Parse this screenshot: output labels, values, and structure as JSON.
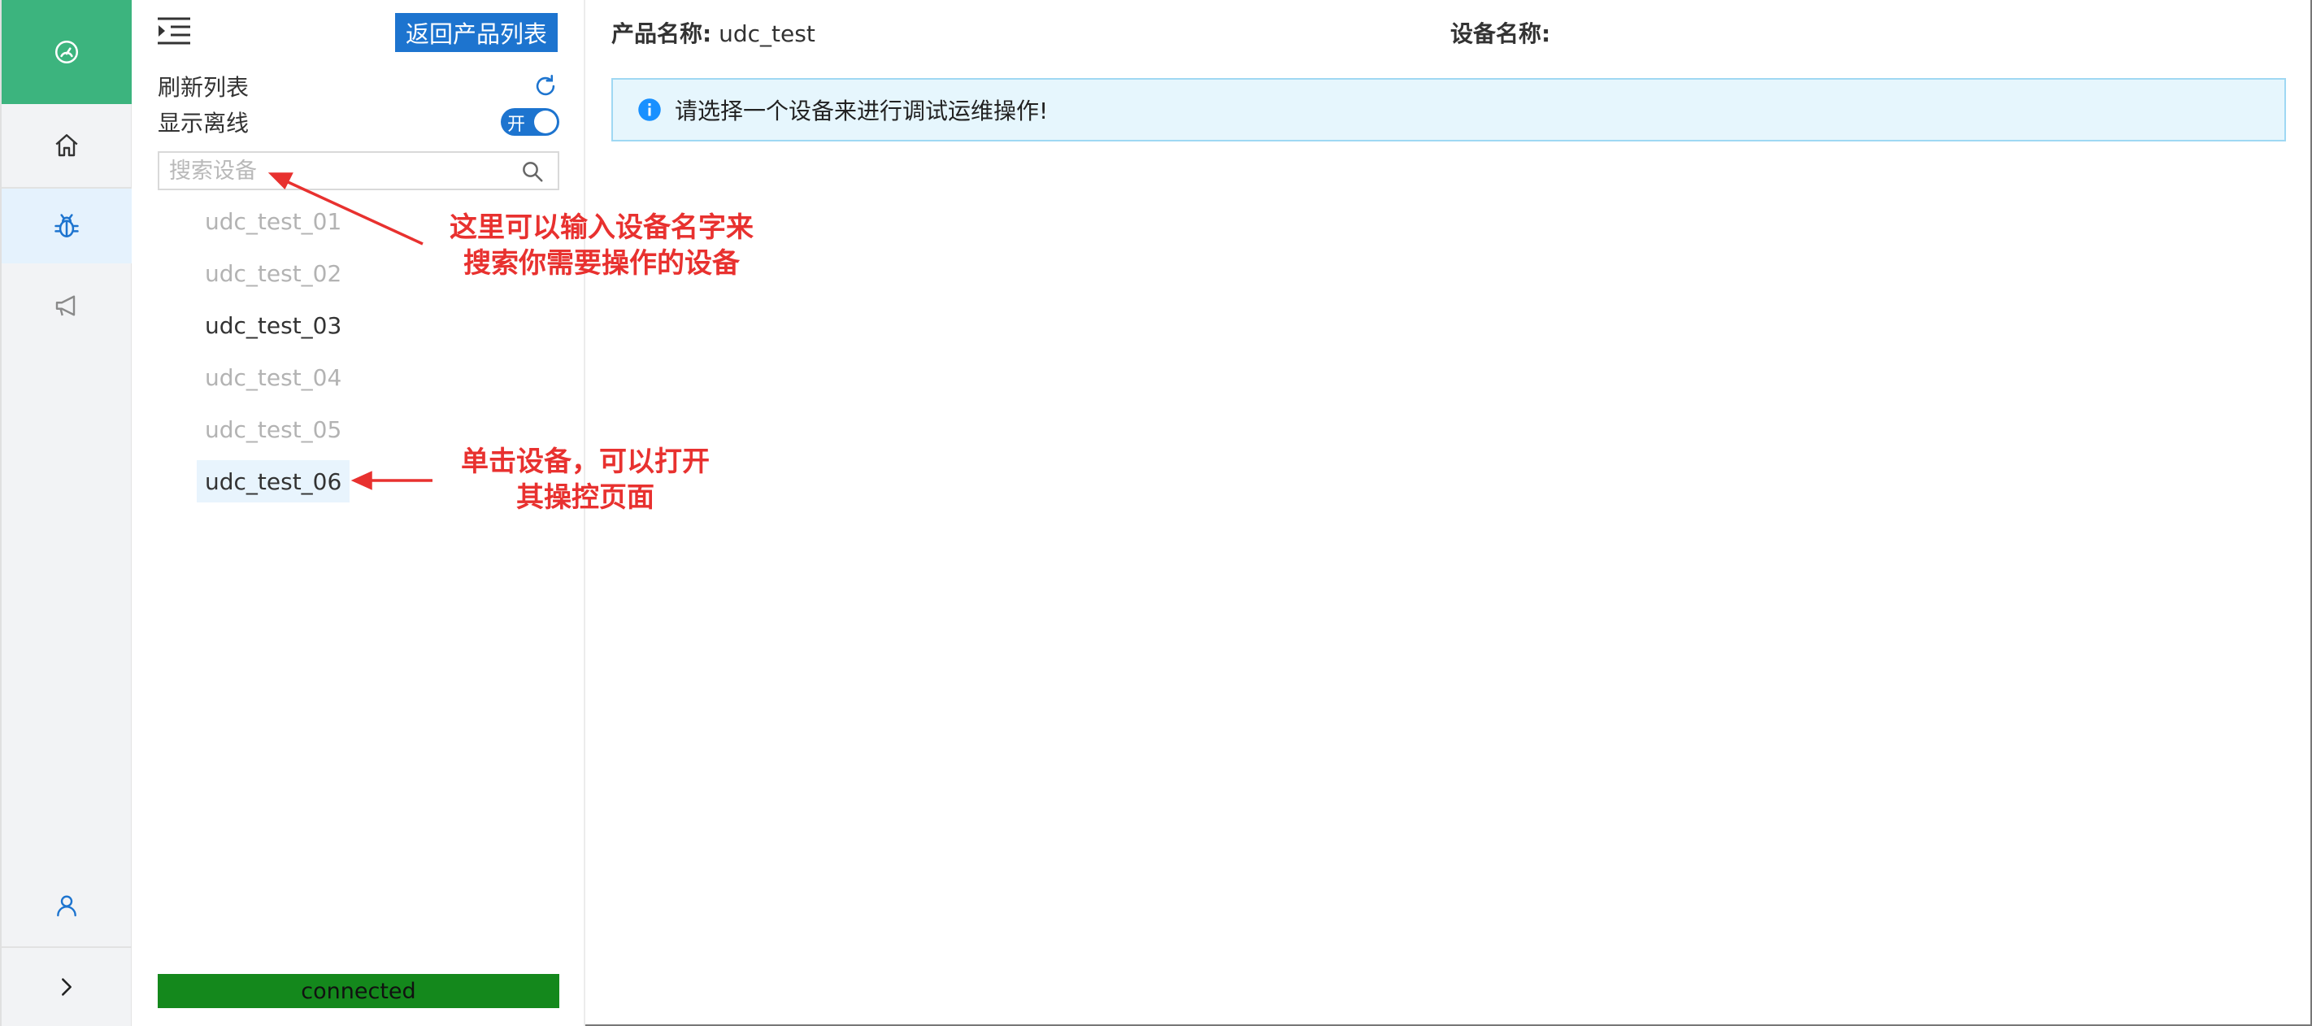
{
  "rail": {
    "items": [
      {
        "id": "dashboard",
        "icon": "dashboard-icon"
      },
      {
        "id": "home",
        "icon": "home-icon"
      },
      {
        "id": "debug",
        "icon": "bug-icon",
        "active": true
      },
      {
        "id": "broadcast",
        "icon": "megaphone-icon"
      },
      {
        "id": "user",
        "icon": "user-icon"
      },
      {
        "id": "expand",
        "icon": "chevron-right-icon"
      }
    ],
    "colors": {
      "logo_bg": "#3cb47e",
      "active_bg": "#e5f2fd",
      "icon": "#333333",
      "active_icon": "#1d74cf"
    }
  },
  "sidebar": {
    "back_button_label": "返回产品列表",
    "refresh_label": "刷新列表",
    "show_offline_label": "显示离线",
    "show_offline_toggle": {
      "on": true,
      "label": "开"
    },
    "search": {
      "placeholder": "搜索设备",
      "value": ""
    },
    "devices": [
      {
        "name": "udc_test_01",
        "online": false,
        "selected": false
      },
      {
        "name": "udc_test_02",
        "online": false,
        "selected": false
      },
      {
        "name": "udc_test_03",
        "online": true,
        "selected": false
      },
      {
        "name": "udc_test_04",
        "online": false,
        "selected": false
      },
      {
        "name": "udc_test_05",
        "online": false,
        "selected": false
      },
      {
        "name": "udc_test_06",
        "online": true,
        "selected": true
      }
    ],
    "status": "connected",
    "colors": {
      "primary": "#1d74cf",
      "status_bg": "#14881c",
      "offline_text": "#b3b3b3"
    }
  },
  "main": {
    "product_label": "产品名称:",
    "product_value": "udc_test",
    "device_label": "设备名称:",
    "device_value": "",
    "notice": "请选择一个设备来进行调试运维操作!",
    "colors": {
      "notice_bg": "#e6f6fd",
      "notice_border": "#9fd8f3",
      "info_icon": "#1890ff"
    }
  },
  "annotations": {
    "search_line1": "这里可以输入设备名字来",
    "search_line2": "搜索你需要操作的设备",
    "click_line1": "单击设备，可以打开",
    "click_line2": "其操控页面",
    "color": "#e8312f"
  }
}
